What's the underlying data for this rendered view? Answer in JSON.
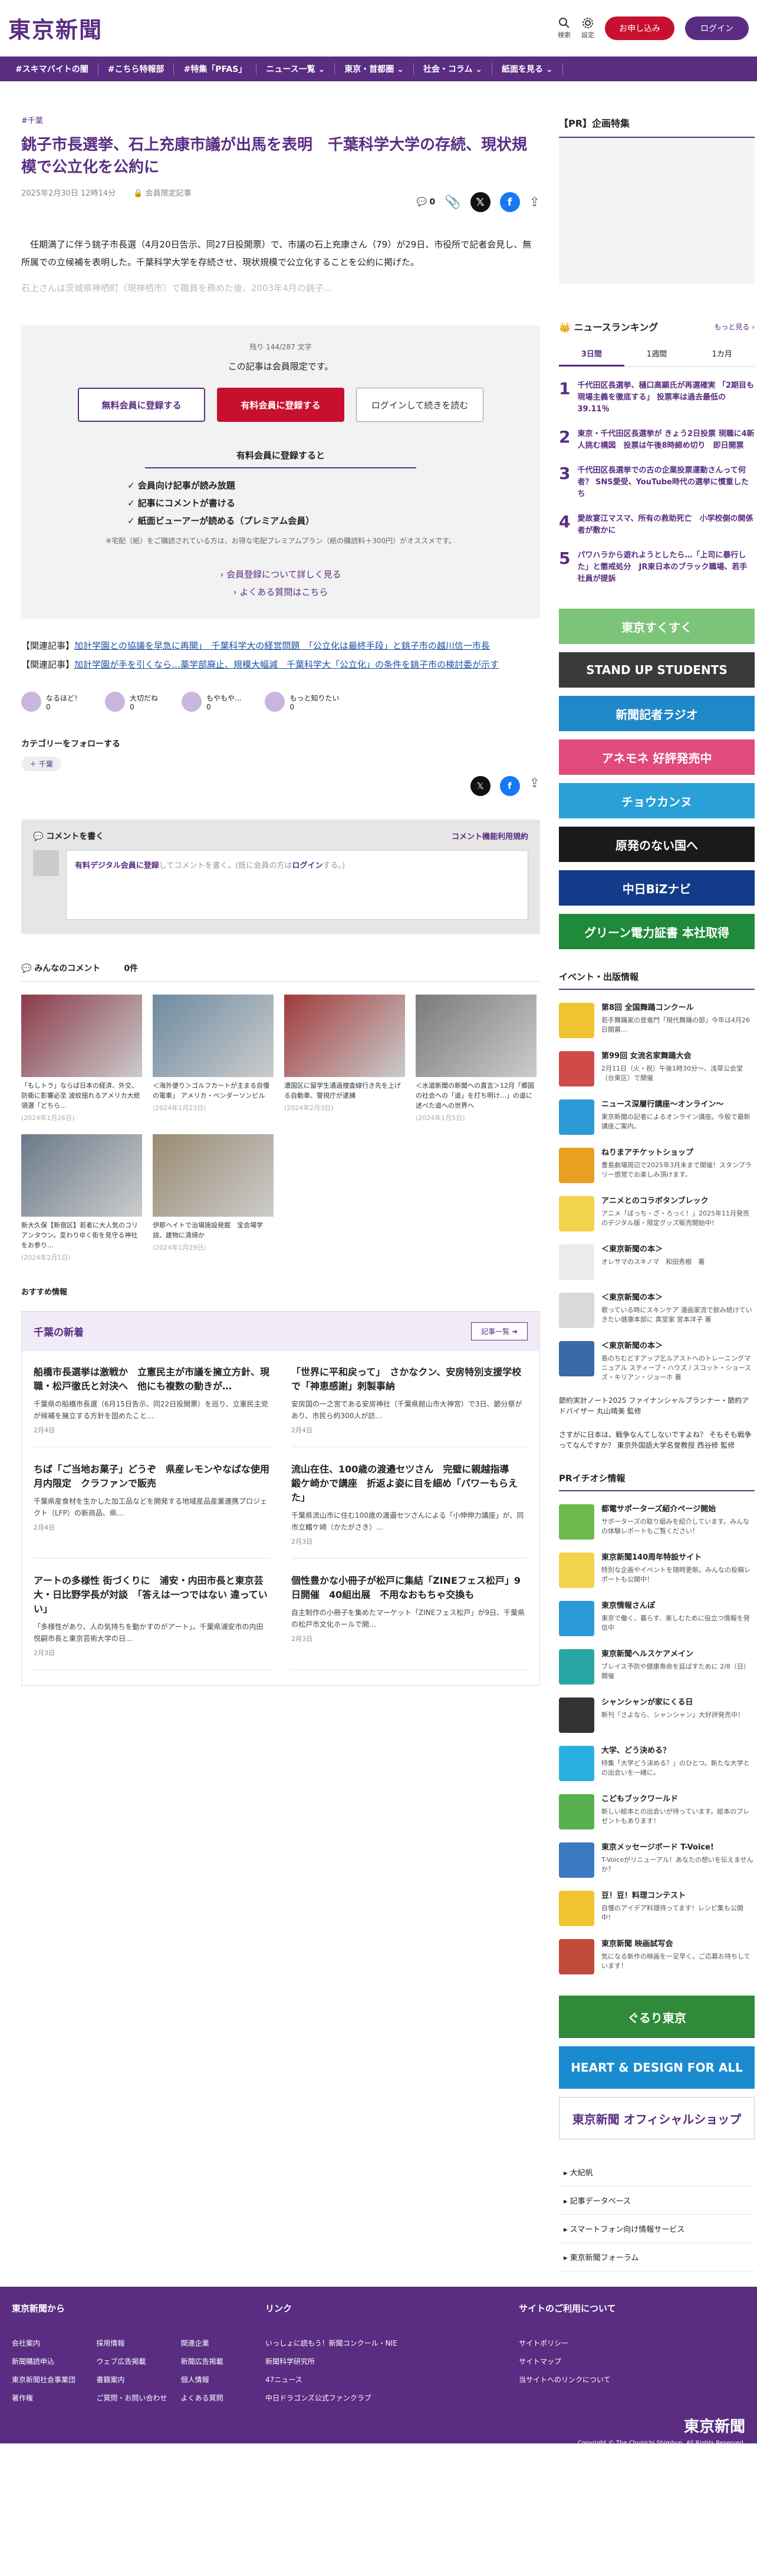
{
  "header": {
    "logo": "東京新聞",
    "search_label": "検索",
    "settings_label": "設定",
    "subscribe_label": "お申し込み",
    "login_label": "ログイン"
  },
  "nav": [
    "#スキマバイトの闇",
    "#こちら特報部",
    "#特集「PFAS」",
    "ニュース一覧 ⌄",
    "東京・首都圏 ⌄",
    "社会・コラム ⌄",
    "紙面を見る ⌄"
  ],
  "article": {
    "category": "#千葉",
    "title": "銚子市長選挙、石上充康市議が出馬を表明　千葉科学大学の存続、現状規模で公立化を公約に",
    "date": "2025年2月30日 12時14分",
    "member_label": "会員限定記事",
    "comment_count": "0",
    "lead": "任期満了に伴う銚子市長選（4月20日告示、同27日投開票）で、市議の石上充康さん（79）が29日、市役所で記者会見し、無所属での立候補を表明した。千葉科学大学を存続させ、現状規模で公立化することを公約に掲げた。",
    "lead_fade": "石上さんは茨城県神栖町（現神栖市）で職員を務めた後、2003年4月の銚子..."
  },
  "paywall": {
    "remain": "残り 144/287 文字",
    "notice": "この記事は会員限定です。",
    "btn_free": "無料会員に登録する",
    "btn_paid": "有料会員に登録する",
    "btn_login": "ログインして続きを読む",
    "benefit_title": "有料会員に登録すると",
    "benefits": [
      "会員向け記事が読み放題",
      "記事にコメントが書ける",
      "紙面ビューアーが読める（プレミアム会員）"
    ],
    "note": "※宅配（紙）をご購読されている方は、お得な宅配プレミアムプラン（紙の購読料＋300円）がオススメです。",
    "link1": "会員登録について詳しく見る",
    "link2": "よくある質問はこちら"
  },
  "related": [
    {
      "tag": "【関連記事】",
      "text": "加計学園との協議を早急に再開」　千葉科学大の経営問題　「公立化は最終手段」と銚子市の越川信一市長"
    },
    {
      "tag": "【関連記事】",
      "text": "加計学園が手を引くなら…薬学部廃止、規模大幅減　千葉科学大「公立化」の条件を銚子市の検討委が示す"
    }
  ],
  "reactions": [
    {
      "label": "なるほど！",
      "count": "0"
    },
    {
      "label": "大切だね",
      "count": "0"
    },
    {
      "label": "もやもや...",
      "count": "0"
    },
    {
      "label": "もっと知りたい",
      "count": "0"
    }
  ],
  "follow": {
    "title": "カテゴリーをフォローする",
    "chip": "＋ 千葉"
  },
  "comments": {
    "write": "コメントを書く",
    "rules": "コメント機能利用規約",
    "prompt_link1": "有料デジタル会員に登録",
    "prompt_mid": "してコメントを書く。(既に会員の方は",
    "prompt_link2": "ログイン",
    "prompt_end": "する。)",
    "everyone": "みんなのコメント",
    "count": "0件"
  },
  "photos": [
    {
      "caption": "「もしトラ」ならば日本の経済、外交、防衛に影響必至 波紋揺れるアメリカ大統領選「どちら…",
      "date": "(2024年1月26日)"
    },
    {
      "caption": "＜海外便り＞ゴルフカートが主まる自慢の電車」 アメリカ・ベンダーソンビル",
      "date": "(2024年1月23日)"
    },
    {
      "caption": "濃国区に留学生通過捜査線行き先を上げる自動車、警視庁が逮捕",
      "date": "(2024年2月3日)"
    },
    {
      "caption": "＜水道新聞の新聞への直言＞12月「郷国の社会への「道」を打ち明け…」の道に述べた道への世界へ",
      "date": "(2024年1月5日)"
    },
    {
      "caption": "新大久保【新宿区】若者に大人気のコリアンタウン。変わりゆく街を見守る神社をお参り…",
      "date": "(2024年2月1日)"
    },
    {
      "caption": "伊那ヘイトで治場施設発掘　宝会場学説、建物に清掃か",
      "date": "(2024年1月29日)"
    }
  ],
  "recommend": "おすすめ情報",
  "local": {
    "title": "千葉の新着",
    "more": "記事一覧 ➜",
    "items": [
      {
        "title": "船橋市長選挙は激戦か　立憲民主が市議を擁立方針、現職・松戸徹氏と対決へ　他にも複数の動きが…",
        "desc": "千葉県の船橋市長選（6月15日告示、同22日投開票）を巡り、立憲民主党が候補を擁立する方針を固めたこと…",
        "date": "2月4日"
      },
      {
        "title": "「世界に平和戻って」　さかなクン、安房特別支援学校で「神恵感謝」刺製事納",
        "desc": "安房国の一之宮である安房神社（千葉県館山市大神宮）で3日、節分祭があり、市民ら約300人が訪…",
        "date": "2月4日"
      },
      {
        "title": "ちば「ご当地お菓子」どうぞ　県産レモンやなばな使用 月内限定　クラファンで販売",
        "desc": "千葉県産食材を生かした加工品などを開発する地域産品産業連携プロジェクト（LFP）の新商品、県…",
        "date": "2月4日"
      },
      {
        "title": "流山在住、100歳の渡邉セツさん　完璧に親越指導　鍛ケ崎かで講座　折返よ姿に目を細め「パワーもらえた」",
        "desc": "千葉県流山市に住む100歳の渡邉セツさんによる「小伸伸力講座」が、同市立鰭ケ崎（かたがさき）…",
        "date": "2月3日"
      },
      {
        "title": "アートの多様性 街づくりに　浦安・内田市長と東京芸大・日比野学長が対談　「答えは一つではない 違っていい」",
        "desc": "「多様性があり、人の気持ちを動かすのがアート」。千葉県浦安市の内田悦嗣市長と東京芸術大学の日…",
        "date": "2月3日"
      },
      {
        "title": "個性豊かな小冊子が松戸に集結「ZINEフェス松戸」9日開催　40組出展　不用なおもちゃ交換も",
        "desc": "自主制作の小冊子を集めたマーケット「ZINEフェス松戸」が9日、千葉県の松戸市文化ホールで開…",
        "date": "2月3日"
      }
    ]
  },
  "sidebar": {
    "pr_title": "【PR】企画特集",
    "ranking_title": "ニュースランキング",
    "ranking_more": "もっと見る ›",
    "tabs": [
      "3日間",
      "1週間",
      "1カ月"
    ],
    "ranking": [
      {
        "no": "1",
        "text": "千代田区長選挙、樋口高顕氏が再選確実 「2期目も現場主義を徹底する」 投票率は過去最低の39.11％"
      },
      {
        "no": "2",
        "text": "東京・千代田区長選挙が きょう2日投票 現職に4新人挑む構図　投票は午後8時締め切り　即日開票"
      },
      {
        "no": "3",
        "text": "千代田区長選挙での古の企業投票運動さんって何者？ SNS愛受、YouTube時代の選挙に慣重したち"
      },
      {
        "no": "4",
        "text": "愛故宴江マスマ、所有の救助死亡　小学校側の関係者が敷かに"
      },
      {
        "no": "5",
        "text": "パワハラから遊れようとしたら…「上司に暴行した」と懲戒処分　JR東日本のブラック職場、若手社員が提訴"
      }
    ],
    "banners": [
      {
        "label": "東京すくすく",
        "color": "#7cc47a"
      },
      {
        "label": "STAND UP STUDENTS",
        "color": "#3a3a3a"
      },
      {
        "label": "新聞記者ラジオ",
        "color": "#1e88c8"
      },
      {
        "label": "アネモネ 好評発売中",
        "color": "#e04b7c"
      },
      {
        "label": "チョウカンヌ",
        "color": "#2aa0d8"
      },
      {
        "label": "原発のない国へ",
        "color": "#1a1a1a"
      },
      {
        "label": "中日BiZナビ",
        "color": "#123b8a"
      },
      {
        "label": "グリーン電力証書 本社取得",
        "color": "#1f8a3a"
      }
    ],
    "event_title": "イベント・出版情報",
    "events": [
      {
        "title": "第8回 全国舞踊コンクール",
        "desc": "若手舞踊家の登竜門「現代舞踊の部」今年は4月26日開幕…",
        "color": "#f0c330"
      },
      {
        "title": "第99回 女流名家舞踊大会",
        "desc": "2月11日（火・祝）午後1時30分～、浅草公会堂（台東区）で開催",
        "color": "#d04a4a"
      },
      {
        "title": "ニュース深層行講座〜オンライン〜",
        "desc": "東京新聞の記者によるオンライン講座。今般で最新講座ご案内。",
        "color": "#2c9ad6"
      },
      {
        "title": "ねりまアチケットショップ",
        "desc": "豊島劇場周辺で2025年3月末まで開催！スタンプラリー感覚でお楽しみ頂けます。",
        "color": "#e8a020"
      },
      {
        "title": "アニメとのコラボタンブレック",
        "desc": "アニメ「ぼっち・ざ・ろっく！」2025年11月発売のデジタル版・限定グッズ販売開始中！",
        "color": "#f3d34a"
      },
      {
        "title": "＜東京新聞の本＞",
        "desc": "オレサマのスキノマ　和田秀樹　著",
        "color": "#ececec"
      },
      {
        "title": "＜東京新聞の本＞",
        "desc": "歌っている時にスキンケア 漫画家流で飲み続けていきたい健康本部に 真堂家 宮本洋子 著",
        "color": "#d9d9d9"
      },
      {
        "title": "＜東京新聞の本＞",
        "desc": "島のちむどすアップ乞ルアストへのトレーニングマニュアル スティーブ・ハウズ / スコット・ショース　ズ・キリアン・ジョーホ 著",
        "color": "#3a6aa8"
      }
    ],
    "text_links": [
      "節約実計ノート2025 ファイナンシャルプランナー・節約アドバイザー 丸山晴美 監修",
      "さすがに日本は、戦争なんてしないですよね？ そもそも戦争ってなんですか？ 東京外国語大学名誉教授 西谷修 監修"
    ],
    "pr_event_title": "PRイチオシ情報",
    "pr_events": [
      {
        "title": "都電サポーターズ紹介ページ開始",
        "desc": "サポーターズの取り組みを紹介しています。みんなの体験レポートもご覧ください！",
        "color": "#6fba4d"
      },
      {
        "title": "東京新聞140周年特設サイト",
        "desc": "特別な企画やイベントを随時更新。みんなの投稿レポートも公開中！",
        "color": "#f3d34a"
      },
      {
        "title": "東京情報さんぽ",
        "desc": "東京で働く、暮らす、楽しむために役立つ情報を発信中",
        "color": "#2c9ad6"
      },
      {
        "title": "東京新聞ヘルスケアメイン",
        "desc": "ブレイス予防や健康寿命を延ばすために 2/8（日）開催",
        "color": "#2aa5a5"
      },
      {
        "title": "シャンシャンが家にくる日",
        "desc": "新刊「さよなら、シャンシャン」大好評発売中！",
        "color": "#333333"
      },
      {
        "title": "大学、どう決める？",
        "desc": "特集「大学どう決める？」のひとつ。新たな大学との出会いを一緒に。",
        "color": "#2ab0e0"
      },
      {
        "title": "こどもブックワールド",
        "desc": "新しい絵本との出会いが待っています。絵本のプレゼントもあります！",
        "color": "#58b050"
      },
      {
        "title": "東京メッセージボード T-Voice!",
        "desc": "T-Voiceがリニューアル！あなたの想いを伝えませんか？",
        "color": "#3a7ac2"
      },
      {
        "title": "豆！豆！料理コンテスト",
        "desc": "自慢のアイデア料理待ってます！レシピ集も公開中！",
        "color": "#f0c330"
      },
      {
        "title": "東京新聞 映画試写会",
        "desc": "気になる新作の映画を一足早く。ご応募お待ちしています！",
        "color": "#c24a3a"
      }
    ],
    "ad_banners": [
      {
        "label": "ぐるり東京",
        "color": "#2f8a3a"
      },
      {
        "label": "HEART & DESIGN FOR ALL",
        "color": "#1b8bd0"
      },
      {
        "label": "東京新聞 オフィシャルショップ",
        "color": "#ffffff"
      }
    ],
    "links": [
      "大紀帆",
      "記事データベース",
      "スマートフォン向け情報サービス",
      "東京新聞フォーラム"
    ]
  },
  "footer": {
    "col1_title": "東京新聞から",
    "col1_links": [
      "会社案内",
      "採用情報",
      "関連企業",
      "新聞購読申込",
      "ウェブ広告掲載",
      "新聞広告掲載",
      "東京新聞社会事業団",
      "書籍案内",
      "個人情報",
      "著作権",
      "ご質問・お問い合わせ",
      "よくある質問"
    ],
    "col2_title": "リンク",
    "col2_links": [
      "いっしょに読もう！新聞コンクール・NIE",
      "新聞科学研究所",
      "47ニュース",
      "中日ドラゴンズ公式ファンクラブ"
    ],
    "col3_title": "サイトのご利用について",
    "col3_links": [
      "サイトポリシー",
      "サイトマップ",
      "当サイトへのリンクについて"
    ],
    "logo": "東京新聞",
    "copyright": "Copyright © The Chunichi Shimbun, All Rights Reserved."
  }
}
